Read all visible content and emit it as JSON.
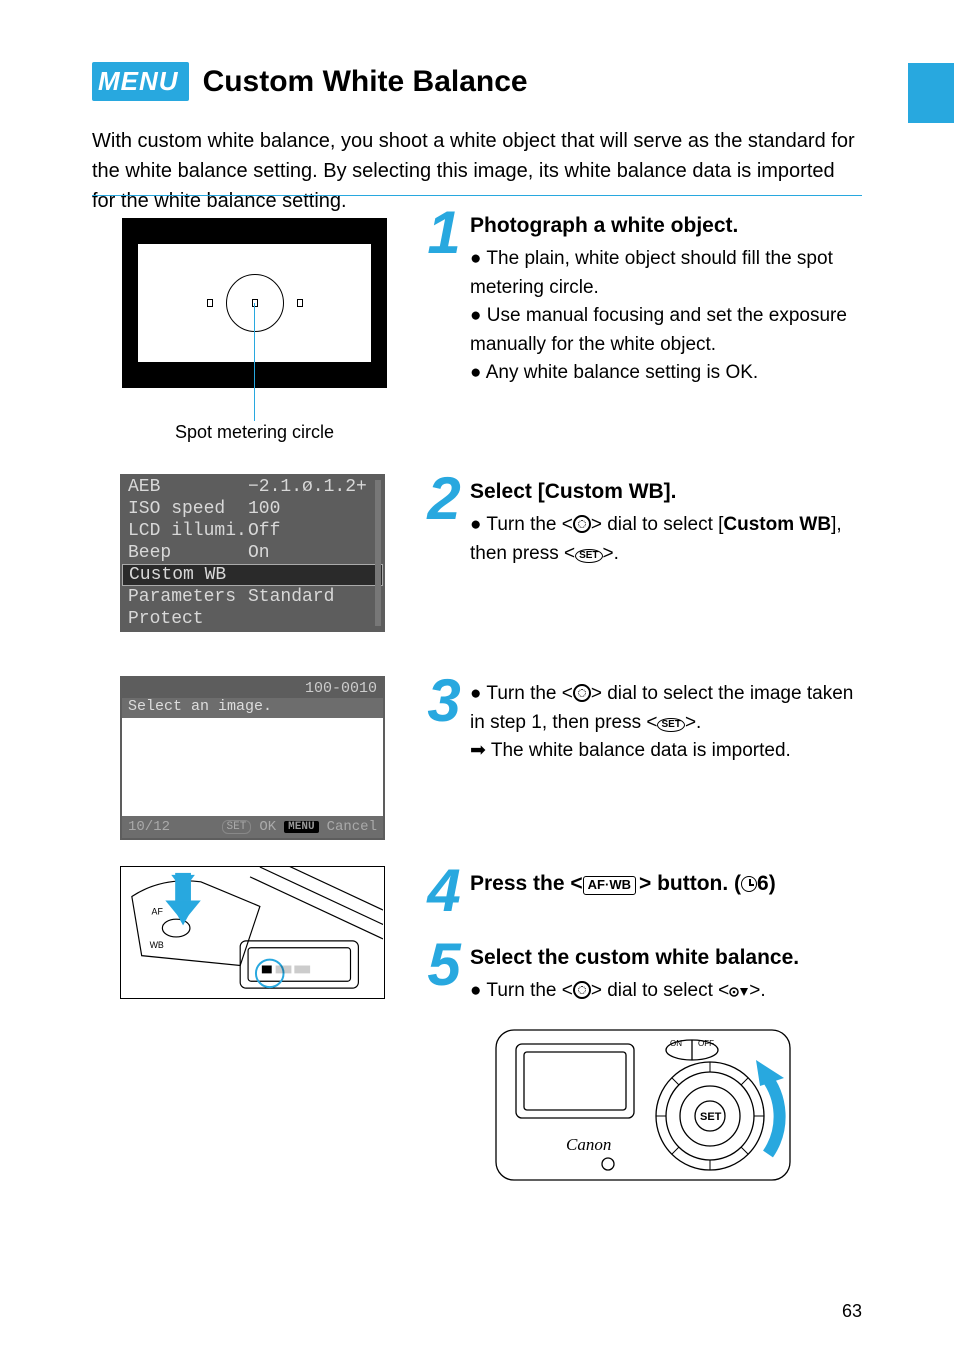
{
  "header": {
    "badge": "MENU",
    "title": "Custom White Balance"
  },
  "intro": "With custom white balance, you shoot a white object that will serve as the standard for the white balance setting. By selecting this image, its white balance data is imported for the white balance setting.",
  "fig1": {
    "caption": "Spot metering circle"
  },
  "lcd_menu": {
    "rows": [
      {
        "label": "AEB",
        "value": "−2.1.ø.1.2+"
      },
      {
        "label": "ISO speed",
        "value": "100"
      },
      {
        "label": "LCD illumi.",
        "value": "Off"
      },
      {
        "label": "Beep",
        "value": "On"
      },
      {
        "label": "Custom WB",
        "value": ""
      },
      {
        "label": "Parameters",
        "value": "Standard"
      },
      {
        "label": "Protect",
        "value": ""
      }
    ],
    "selected_index": 4
  },
  "lcd_select": {
    "top_right": "100-0010",
    "prompt": "Select an image.",
    "counter": "10/12",
    "set_label": "SET",
    "ok_label": "OK",
    "menu_label": "MENU",
    "cancel_label": "Cancel"
  },
  "camera_fig": {
    "arrow_color": "#28a8df",
    "wb_label": "WB",
    "af_label": "AF"
  },
  "steps": {
    "s1": {
      "num": "1",
      "title": "Photograph a white object.",
      "lines": [
        "The plain, white object should fill the spot metering circle.",
        "Use manual focusing and set the exposure manually for the white object.",
        "Any white balance setting is OK."
      ]
    },
    "s2": {
      "num": "2",
      "title": "Select [Custom WB].",
      "line_prefix": "Turn the <",
      "line_mid1": "> dial to select [",
      "bold1": "Custom WB",
      "line_mid2": "], then press <",
      "line_end": ">."
    },
    "s3": {
      "num": "3",
      "line_a1": "Turn the <",
      "line_a2": "> dial to select the image taken in step 1, then press <",
      "line_a3": ">.",
      "arrow_prefix": "The white balance data is imported."
    },
    "s4": {
      "num": "4",
      "line_a": "Press the <",
      "af_label": "AF·WB",
      "line_b": "> button. (",
      "timer_suffix": "6",
      "line_c": ")"
    },
    "s5": {
      "num": "5",
      "title": "Select the custom white balance.",
      "line_a": "Turn the <",
      "line_b": "> dial to select <",
      "line_c": ">."
    }
  },
  "camera_back": {
    "set_label": "SET",
    "brand": "Canon",
    "on": "ON",
    "off": "OFF"
  },
  "page_no": "63"
}
